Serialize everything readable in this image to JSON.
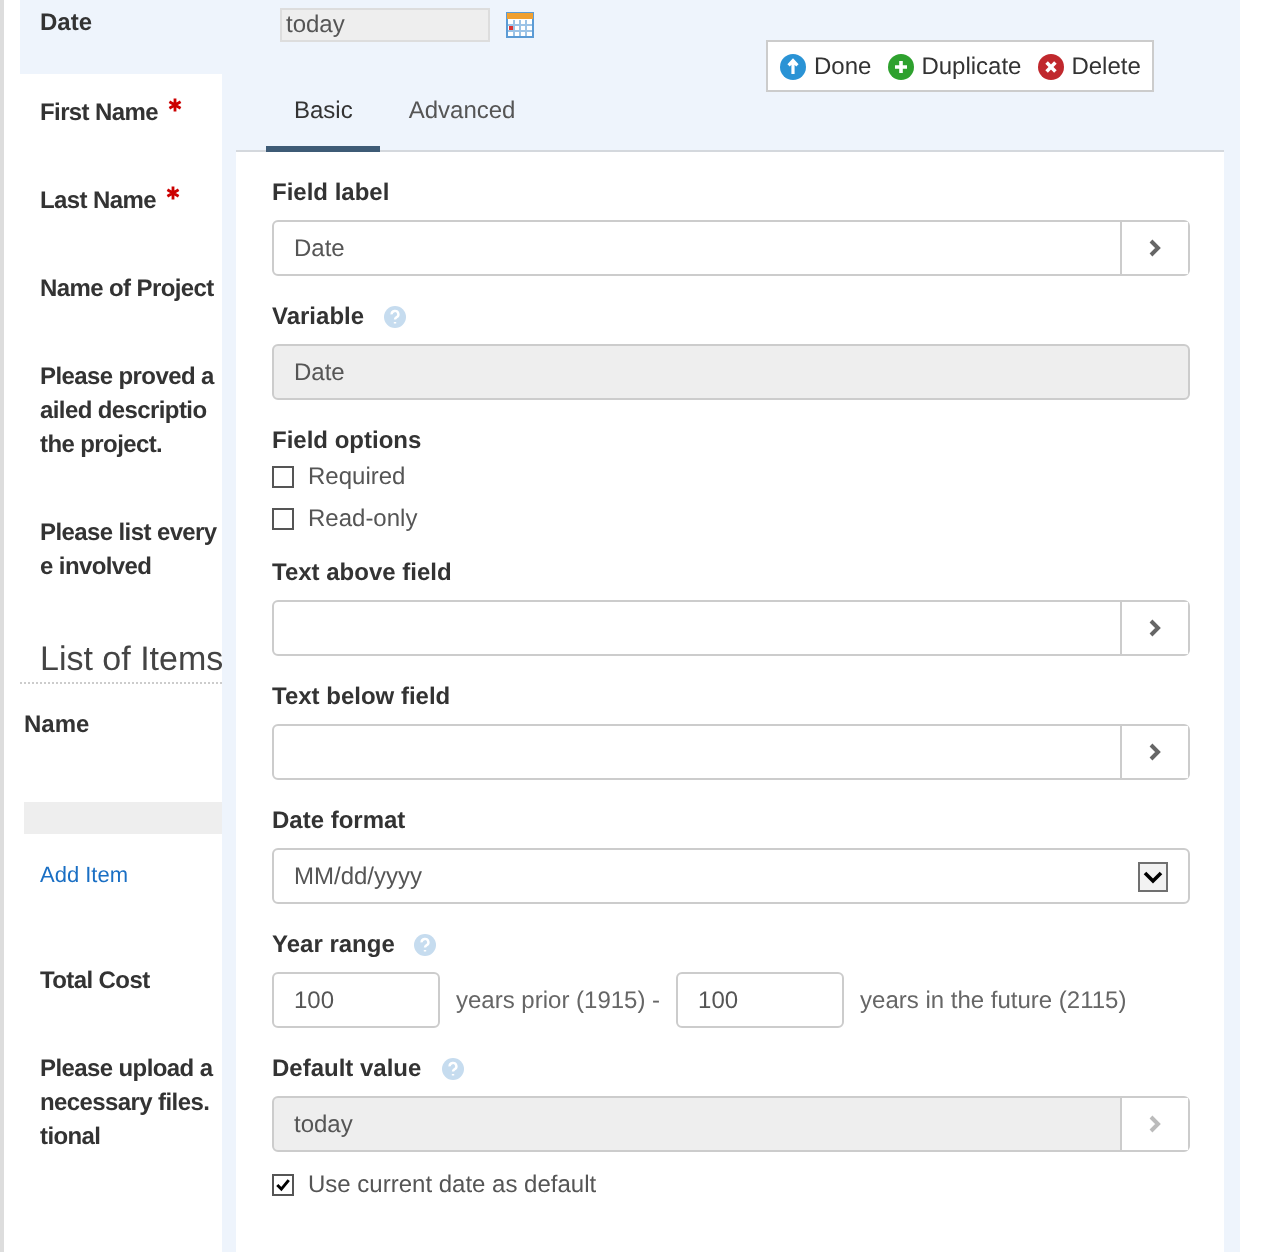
{
  "date_row": {
    "label": "Date",
    "value": "today"
  },
  "form_items": [
    {
      "kind": "label",
      "text": "First Name",
      "required": true
    },
    {
      "kind": "label",
      "text": "Last Name",
      "required": true
    },
    {
      "kind": "label",
      "text": "Name of Project",
      "required": false
    },
    {
      "kind": "label",
      "text": "Please proved a\nailed descriptio\nthe project.",
      "required": false
    },
    {
      "kind": "label",
      "text": "Please list every\ne involved",
      "required": false
    },
    {
      "kind": "section",
      "text": "List of Items"
    },
    {
      "kind": "column",
      "text": "Name"
    },
    {
      "kind": "bar"
    },
    {
      "kind": "link",
      "text": "Add Item"
    },
    {
      "kind": "label",
      "text": "Total Cost",
      "required": false
    },
    {
      "kind": "label",
      "text": "Please upload a\nnecessary files.\ntional",
      "required": false
    }
  ],
  "toolbar": [
    {
      "kind": "done",
      "label": "Done"
    },
    {
      "kind": "duplicate",
      "label": "Duplicate"
    },
    {
      "kind": "delete",
      "label": "Delete"
    }
  ],
  "tabs": [
    {
      "label": "Basic",
      "selected": true
    },
    {
      "label": "Advanced",
      "selected": false
    }
  ],
  "settings": [
    {
      "kind": "text",
      "label": "Field label",
      "value": "Date",
      "help": false,
      "disabled": false,
      "addon": true
    },
    {
      "kind": "text",
      "label": "Variable",
      "value": "Date",
      "help": true,
      "disabled": true,
      "addon": false
    },
    {
      "kind": "checks",
      "label": "Field options",
      "help": false,
      "options": [
        {
          "label": "Required",
          "checked": false
        },
        {
          "label": "Read-only",
          "checked": false
        }
      ]
    },
    {
      "kind": "text",
      "label": "Text above field",
      "help": false,
      "disabled": false,
      "addon": true
    },
    {
      "kind": "text",
      "label": "Text below field",
      "help": false,
      "disabled": false,
      "addon": true
    },
    {
      "kind": "select",
      "label": "Date format",
      "value": "MM/dd/yyyy",
      "help": false
    },
    {
      "kind": "range",
      "label": "Year range",
      "help": true,
      "prior": "100",
      "prior_text": "years prior (1915) -",
      "future": "100",
      "future_text": "years in the future (2115)"
    },
    {
      "kind": "text",
      "label": "Default value",
      "value": "today",
      "help": true,
      "disabled": true,
      "addon": true
    },
    {
      "kind": "checks",
      "options": [
        {
          "label": "Use current date as default",
          "checked": true
        }
      ]
    }
  ]
}
